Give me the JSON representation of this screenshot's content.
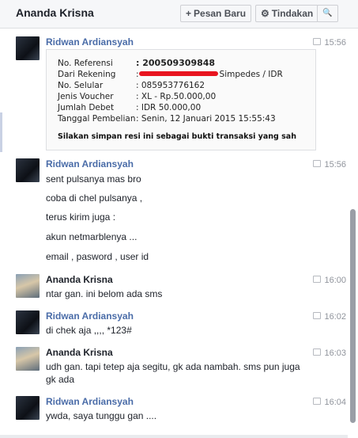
{
  "header": {
    "title": "Ananda Krisna",
    "new_message_label": "Pesan Baru",
    "actions_label": "Tindakan",
    "new_message_icon": "+",
    "actions_icon": "⚙",
    "search_icon": "🔍"
  },
  "receipt": {
    "rows": [
      {
        "label": "No. Referensi",
        "value": ": 200509309848"
      },
      {
        "label": "Dari Rekening",
        "value": "Simpedes / IDR"
      },
      {
        "label": "No. Selular",
        "value": ": 085953776162"
      },
      {
        "label": "Jenis Voucher",
        "value": ": XL - Rp.50.000,00"
      },
      {
        "label": "Jumlah Debet",
        "value": ": IDR 50.000,00"
      },
      {
        "label": "Tanggal Pembelian",
        "value": ": Senin, 12 Januari 2015 15:55:43"
      }
    ],
    "note": "Silakan simpan resi ini sebagai bukti transaksi yang sah",
    "rekening_prefix": ":"
  },
  "messages": [
    {
      "sender": "Ridwan Ardiansyah",
      "time": "15:56"
    },
    {
      "sender": "Ridwan Ardiansyah",
      "time": "15:56",
      "lines": [
        "sent pulsanya mas bro",
        "coba di chel pulsanya ,",
        "terus kirim juga :",
        "akun netmarblenya ...",
        "email , pasword , user id"
      ]
    },
    {
      "sender": "Ananda Krisna",
      "time": "16:00",
      "lines": [
        "ntar gan. ini belom ada sms"
      ]
    },
    {
      "sender": "Ridwan Ardiansyah",
      "time": "16:02",
      "lines": [
        "di chek aja ,,,, *123#"
      ]
    },
    {
      "sender": "Ananda Krisna",
      "time": "16:03",
      "lines": [
        "udh gan. tapi tetep aja segitu, gk ada nambah. sms pun juga",
        "gk ada"
      ]
    },
    {
      "sender": "Ridwan Ardiansyah",
      "time": "16:04",
      "lines": [
        "ywda, saya tunggu gan ...."
      ]
    }
  ]
}
